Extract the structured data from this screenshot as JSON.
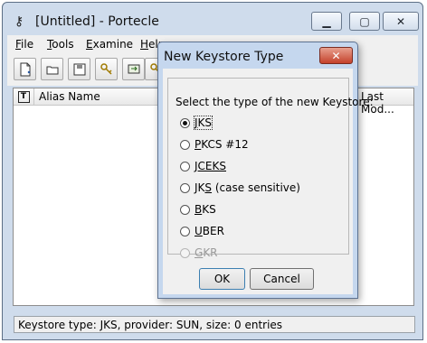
{
  "window": {
    "title": "[Untitled] - Portecle",
    "min_glyph": "▁",
    "max_glyph": "▢",
    "close_glyph": "✕"
  },
  "menu": [
    {
      "mnemonic": "F",
      "rest": "ile"
    },
    {
      "mnemonic": "T",
      "rest": "ools"
    },
    {
      "mnemonic": "E",
      "rest": "xamine"
    },
    {
      "mnemonic": "H",
      "rest": "elp"
    }
  ],
  "toolbar": {
    "icons": [
      "new-keystore-icon",
      "open-keystore-icon",
      "save-keystore-icon",
      "generate-keypair-icon",
      "import-keypair-icon",
      "set-password-icon"
    ]
  },
  "table": {
    "type_column": "T",
    "columns": [
      "Alias Name",
      "Last Mod..."
    ]
  },
  "status_bar": {
    "text": "Keystore type: JKS, provider: SUN, size: 0 entries"
  },
  "dialog": {
    "title": "New Keystore Type",
    "close_glyph": "✕",
    "group_label": "Select the type of the new Keystore:",
    "options": [
      {
        "mnemonic": "J",
        "rest": "KS",
        "checked": true,
        "disabled": false
      },
      {
        "mnemonic": "P",
        "rest": "KCS #12",
        "checked": false,
        "disabled": false
      },
      {
        "mnemonic": "J",
        "rest": "CEKS",
        "checked": false,
        "disabled": false
      },
      {
        "pre": "JK",
        "mnemonic": "S",
        "rest": " (case sensitive)",
        "checked": false,
        "disabled": false
      },
      {
        "mnemonic": "B",
        "rest": "KS",
        "checked": false,
        "disabled": false
      },
      {
        "mnemonic": "U",
        "rest": "BER",
        "checked": false,
        "disabled": false
      },
      {
        "mnemonic": "G",
        "rest": "KR",
        "checked": false,
        "disabled": true
      }
    ],
    "ok_label": "OK",
    "cancel_label": "Cancel"
  },
  "colors": {
    "window_frame": "#cfdcec",
    "dialog_frame": "#c5d7ee",
    "close_button": "#c5422b"
  }
}
